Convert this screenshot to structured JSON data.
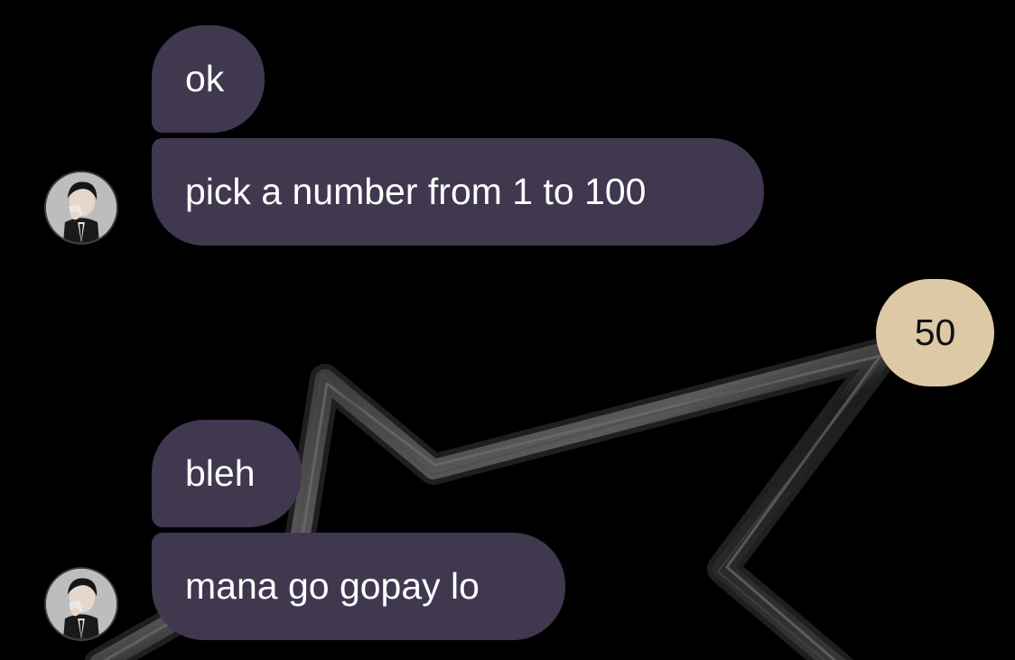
{
  "conversation": {
    "messages": [
      {
        "sender": "them",
        "text": "ok"
      },
      {
        "sender": "them",
        "text": "pick a number from 1 to 100"
      },
      {
        "sender": "me",
        "text": "50"
      },
      {
        "sender": "them",
        "text": "bleh"
      },
      {
        "sender": "them",
        "text": "mana go gopay lo"
      }
    ]
  },
  "colors": {
    "background": "#000000",
    "incoming_bubble": "#3f384f",
    "outgoing_bubble": "#ddc9a6"
  },
  "icons": {
    "avatar": "contact-avatar-photo",
    "background_decoration": "chrome-star-shape"
  }
}
